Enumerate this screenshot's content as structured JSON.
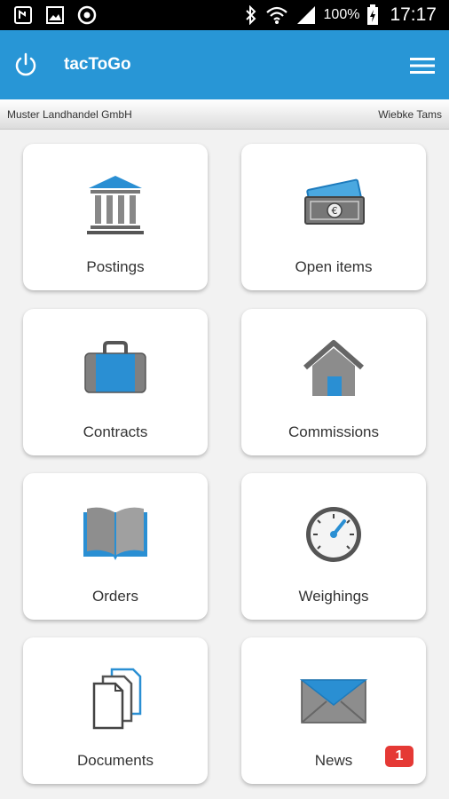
{
  "status_bar": {
    "battery_percent": "100%",
    "time": "17:17",
    "icons": [
      "nfc-icon",
      "image-icon",
      "sync-icon",
      "bluetooth-icon",
      "wifi-icon",
      "signal-icon",
      "battery-charging-icon"
    ]
  },
  "app_bar": {
    "title": "tacToGo",
    "color": "#2896d6"
  },
  "sub_bar": {
    "company": "Muster Landhandel GmbH",
    "user": "Wiebke Tams"
  },
  "tiles": [
    {
      "label": "Postings",
      "icon": "bank-icon"
    },
    {
      "label": "Open items",
      "icon": "money-icon"
    },
    {
      "label": "Contracts",
      "icon": "briefcase-icon"
    },
    {
      "label": "Commissions",
      "icon": "house-icon"
    },
    {
      "label": "Orders",
      "icon": "book-icon"
    },
    {
      "label": "Weighings",
      "icon": "gauge-icon"
    },
    {
      "label": "Documents",
      "icon": "documents-icon"
    },
    {
      "label": "News",
      "icon": "envelope-icon",
      "badge": "1"
    }
  ],
  "colors": {
    "badge": "#e53935",
    "accent": "#2896d6"
  }
}
